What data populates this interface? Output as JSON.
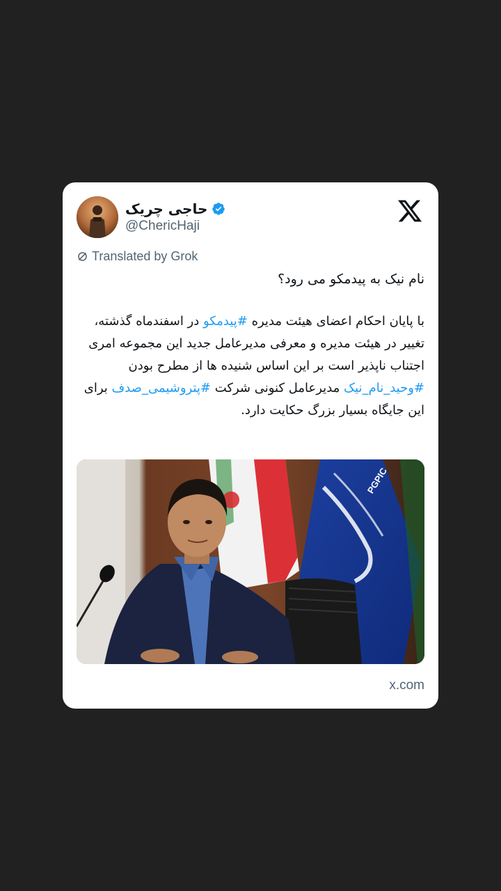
{
  "author": {
    "display_name": "حاجی چریک",
    "handle": "@ChericHaji",
    "verified": true
  },
  "translation": {
    "label": "Translated by Grok"
  },
  "tweet": {
    "title": "نام نیک به پیدمکو می رود؟",
    "body_parts": [
      {
        "text": "با پایان احکام اعضای هیئت مدیره ",
        "hashtag": false
      },
      {
        "text": "#پیدمکو",
        "hashtag": true
      },
      {
        "text": " در اسفندماه گذشته، تغییر در هیئت مدیره و معرفی مدیرعامل جدید این مجموعه امری اجتناب ناپذیر است بر این اساس شنیده ها از مطرح بودن ",
        "hashtag": false
      },
      {
        "text": "#وحید_نام_نیک",
        "hashtag": true
      },
      {
        "text": " مدیرعامل کنونی شرکت ",
        "hashtag": false
      },
      {
        "text": "#پتروشیمی_صدف",
        "hashtag": true
      },
      {
        "text": " برای این جایگاه بسیار بزرگ حکایت دارد.",
        "hashtag": false
      }
    ]
  },
  "media": {
    "flag_logo_text": "PGPIC"
  },
  "footer": {
    "link": "x.com"
  },
  "icons": {
    "brand": "x-logo-icon",
    "verified": "verified-badge-icon",
    "translate": "translate-icon"
  },
  "colors": {
    "background": "#212121",
    "card": "#ffffff",
    "text": "#0f1419",
    "secondary": "#536471",
    "link": "#1d9bf0"
  }
}
